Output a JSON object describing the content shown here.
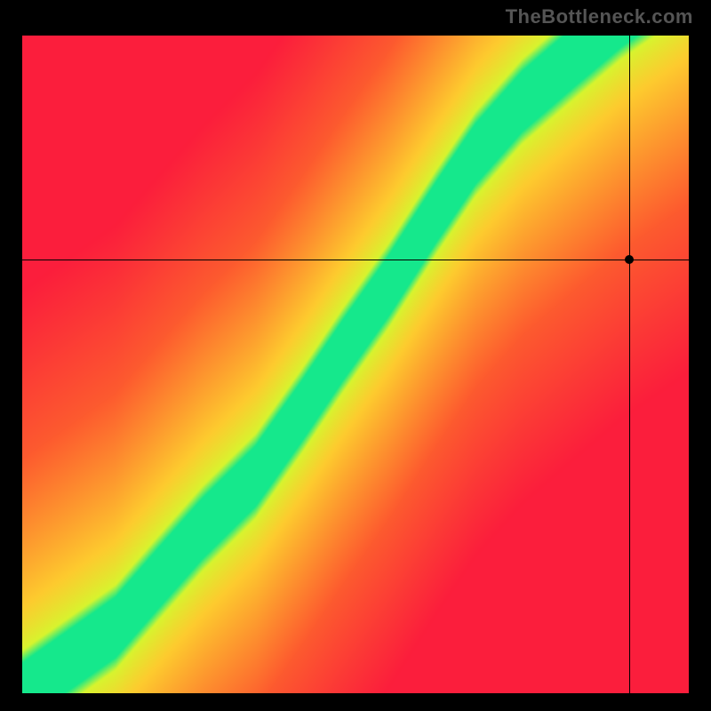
{
  "watermark": "TheBottleneck.com",
  "chart_data": {
    "type": "heatmap",
    "title": "",
    "xlabel": "",
    "ylabel": "",
    "xlim": [
      0,
      100
    ],
    "ylim": [
      0,
      100
    ],
    "grid": false,
    "legend": false,
    "colorscale_description": "red (worst) → orange → yellow → green (best) → yellow → orange → red",
    "colorscale_stops": [
      {
        "t": 0.0,
        "hex": "#fb1e3c"
      },
      {
        "t": 0.2,
        "hex": "#fd5b2f"
      },
      {
        "t": 0.4,
        "hex": "#fecb2e"
      },
      {
        "t": 0.48,
        "hex": "#d7f52f"
      },
      {
        "t": 0.5,
        "hex": "#15e88c"
      },
      {
        "t": 0.52,
        "hex": "#d7f52f"
      },
      {
        "t": 0.6,
        "hex": "#fecb2e"
      },
      {
        "t": 0.8,
        "hex": "#fd5b2f"
      },
      {
        "t": 1.0,
        "hex": "#fb1e3c"
      }
    ],
    "optimal_curve_points": [
      {
        "x": 0,
        "y": 0
      },
      {
        "x": 7,
        "y": 5
      },
      {
        "x": 14,
        "y": 10
      },
      {
        "x": 20,
        "y": 17
      },
      {
        "x": 27,
        "y": 25
      },
      {
        "x": 35,
        "y": 33
      },
      {
        "x": 42,
        "y": 43
      },
      {
        "x": 48,
        "y": 52
      },
      {
        "x": 55,
        "y": 62
      },
      {
        "x": 62,
        "y": 73
      },
      {
        "x": 68,
        "y": 82
      },
      {
        "x": 75,
        "y": 90
      },
      {
        "x": 83,
        "y": 97
      },
      {
        "x": 90,
        "y": 103
      },
      {
        "x": 100,
        "y": 110
      }
    ],
    "band_halfwidth_vertical": 6.5,
    "marker_point": {
      "x": 91,
      "y": 66
    },
    "crosshair": {
      "x": 91,
      "y": 66
    }
  }
}
